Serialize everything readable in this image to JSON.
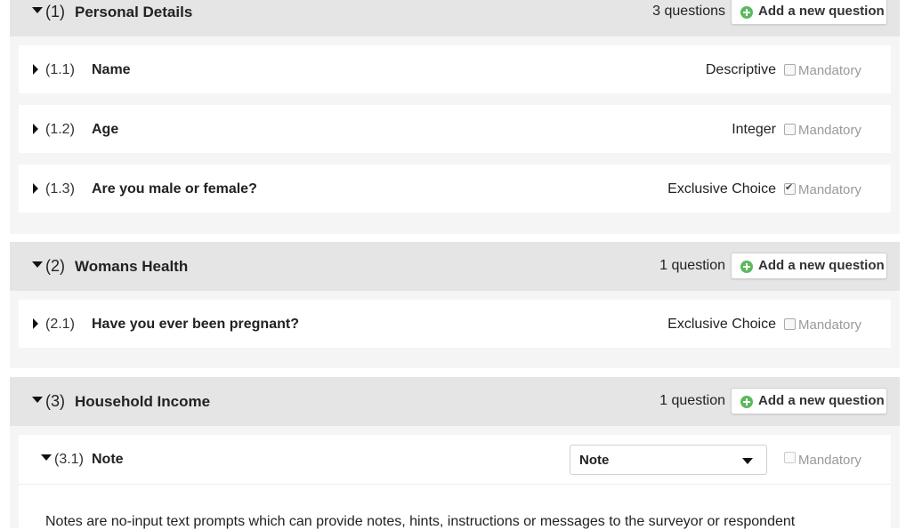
{
  "sections": [
    {
      "number": "(1)",
      "title": "Personal Details",
      "count": "3 questions",
      "add_label": "Add a new question",
      "questions": [
        {
          "number": "(1.1)",
          "title": "Name",
          "type": "Descriptive",
          "mandatory_label": "Mandatory",
          "mandatory": false
        },
        {
          "number": "(1.2)",
          "title": "Age",
          "type": "Integer",
          "mandatory_label": "Mandatory",
          "mandatory": false
        },
        {
          "number": "(1.3)",
          "title": "Are you male or female?",
          "type": "Exclusive Choice",
          "mandatory_label": "Mandatory",
          "mandatory": true
        }
      ]
    },
    {
      "number": "(2)",
      "title": "Womans Health",
      "count": "1 question",
      "add_label": "Add a new question",
      "questions": [
        {
          "number": "(2.1)",
          "title": "Have you ever been pregnant?",
          "type": "Exclusive Choice",
          "mandatory_label": "Mandatory",
          "mandatory": false
        }
      ]
    },
    {
      "number": "(3)",
      "title": "Household Income",
      "count": "1 question",
      "add_label": "Add a new question",
      "questions": [
        {
          "number": "(3.1)",
          "title": "Note",
          "type_select": "Note",
          "mandatory_label": "Mandatory",
          "mandatory": false,
          "description": "Notes are no-input text prompts which can provide notes, hints, instructions or messages to the surveyor or respondent"
        }
      ]
    }
  ],
  "icons": {
    "add": "plus-circle-icon",
    "expand": "caret-right-icon",
    "collapse": "caret-down-icon",
    "dropdown": "chevron-down-icon"
  },
  "colors": {
    "header_bg": "#e5e5e5",
    "section_bg": "#f5f5f5",
    "add_icon": "#5cb85c",
    "muted_text": "#9a9a9a"
  }
}
